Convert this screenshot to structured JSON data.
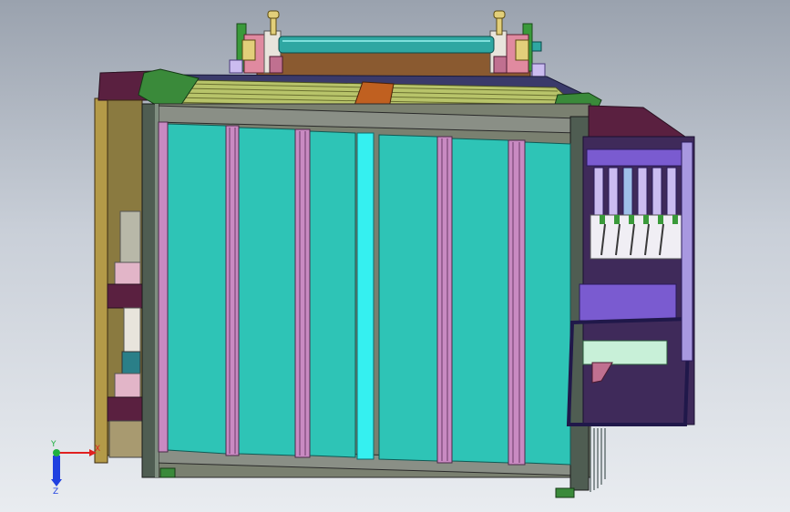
{
  "viewport": {
    "background_top": "#9aa2ae",
    "background_bottom": "#e9ecf0"
  },
  "model": {
    "colors": {
      "panel_teal": "#2ec4b6",
      "panel_highlight": "#35f0f0",
      "frame_gray": "#8a8f86",
      "frame_dark": "#4f5d52",
      "stripe_pink": "#c98ac2",
      "top_olive": "#b8c46a",
      "clip_green": "#3a8a3a",
      "clip_orange": "#c06020",
      "roller_teal": "#2fa7a2",
      "bracket_pink": "#e08aa0",
      "knob_gold": "#e2cf7a",
      "side_purple": "#7a5bd0",
      "side_dark": "#3f2a5a",
      "side_lilac": "#cbbcf0",
      "insert_mint": "#c8f0d8",
      "left_tan": "#b49a48",
      "left_maroon": "#5a2040",
      "left_pink": "#e2b5c8",
      "left_teal": "#2a7f88"
    }
  },
  "triad": {
    "x_label": "X",
    "y_label": "Y",
    "z_label": "Z",
    "x_color": "#e02020",
    "y_color": "#20b040",
    "z_color": "#2040e0"
  }
}
